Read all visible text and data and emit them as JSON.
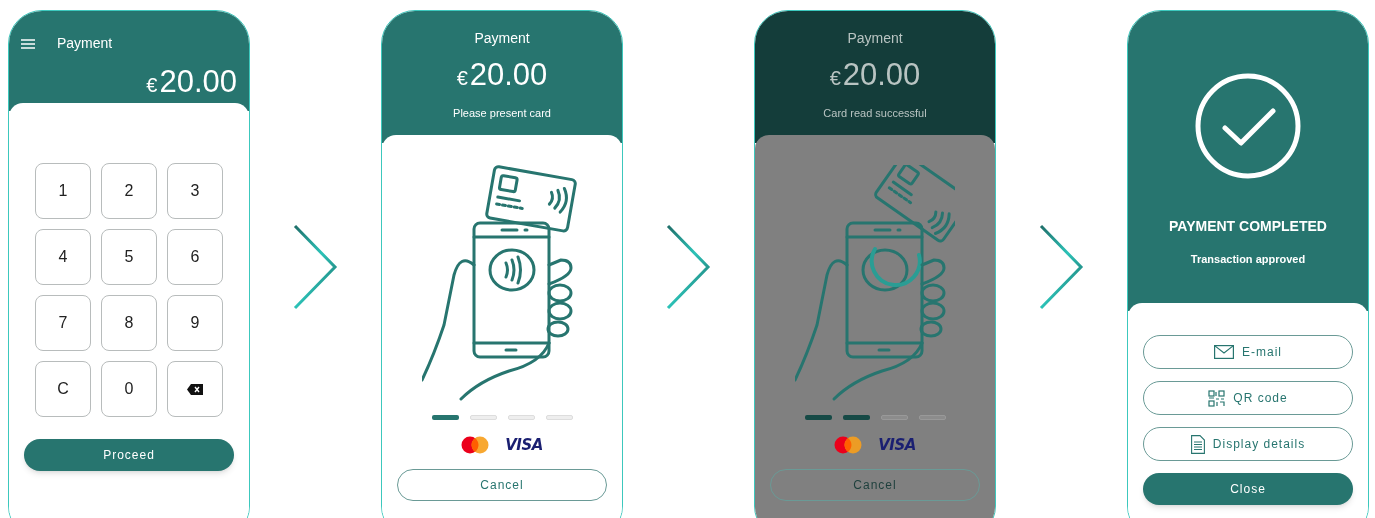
{
  "screens": [
    {
      "kind": "keypad",
      "title": "Payment",
      "amount": {
        "currency": "€",
        "value": "20.00"
      },
      "keys": [
        {
          "kind": "digit",
          "label": "1"
        },
        {
          "kind": "digit",
          "label": "2"
        },
        {
          "kind": "digit",
          "label": "3"
        },
        {
          "kind": "digit",
          "label": "4"
        },
        {
          "kind": "digit",
          "label": "5"
        },
        {
          "kind": "digit",
          "label": "6"
        },
        {
          "kind": "digit",
          "label": "7"
        },
        {
          "kind": "digit",
          "label": "8"
        },
        {
          "kind": "digit",
          "label": "9"
        },
        {
          "kind": "digit",
          "label": "C"
        },
        {
          "kind": "digit",
          "label": "0"
        },
        {
          "kind": "backspace"
        }
      ],
      "button": "Proceed"
    },
    {
      "kind": "present",
      "dimmed": false,
      "title": "Payment",
      "amount": {
        "currency": "€",
        "value": "20.00"
      },
      "status": "Please present card",
      "steps": [
        {
          "done": true
        },
        {
          "done": false
        },
        {
          "done": false
        },
        {
          "done": false
        }
      ],
      "card_brand": "VISA",
      "button": "Cancel"
    },
    {
      "kind": "reading",
      "dimmed": true,
      "title": "Payment",
      "amount": {
        "currency": "€",
        "value": "20.00"
      },
      "status": "Card read successful",
      "steps": [
        {
          "done": true
        },
        {
          "done": true
        },
        {
          "done": false
        },
        {
          "done": false
        }
      ],
      "card_brand": "VISA",
      "button": "Cancel"
    },
    {
      "kind": "completed",
      "heading": "PAYMENT COMPLETED",
      "subheading": "Transaction approved",
      "options": [
        {
          "kind": "email",
          "label": "E-mail"
        },
        {
          "kind": "qr",
          "label": "QR code"
        },
        {
          "kind": "details",
          "label": "Display details"
        }
      ],
      "button": "Close"
    }
  ]
}
